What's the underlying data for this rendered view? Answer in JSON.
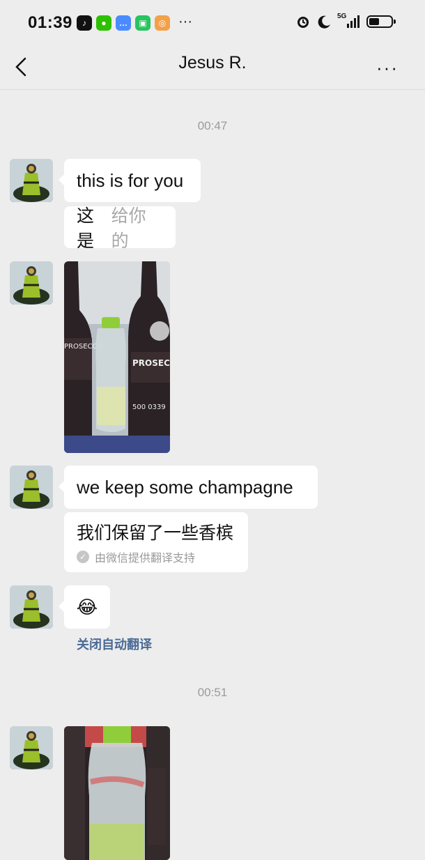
{
  "status_bar": {
    "time": "01:39",
    "notification_icons": [
      "tiktok-icon",
      "wechat-icon",
      "messages-icon",
      "iqiyi-icon",
      "search-app-icon"
    ],
    "more": "···",
    "network": "5G",
    "battery_level": 0.45
  },
  "header": {
    "title": "Jesus R.",
    "more": "···"
  },
  "messages": {
    "timestamp_1": "00:47",
    "msg1_text": "this is for you",
    "msg2_prefix": "这是",
    "msg2_rest": "给你的",
    "msg4_text": "we keep some champagne",
    "msg5_text": "我们保留了一些香槟",
    "msg5_note": "由微信提供翻译支持",
    "msg6_emoji": "😂",
    "close_translation": "关闭自动翻译",
    "timestamp_2": "00:51"
  },
  "photo_labels": {
    "brand": "PROSECCO",
    "code": "500 0339"
  }
}
